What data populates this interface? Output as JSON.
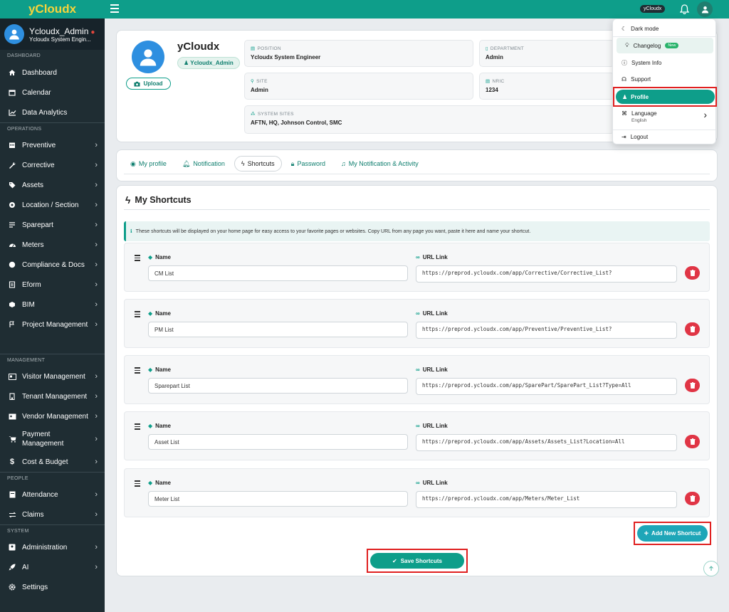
{
  "app": {
    "brand": "yCloudx",
    "top_badge": "yCloudx"
  },
  "user": {
    "name": "Ycloudx_Admin",
    "role": "Ycloudx System Engin..."
  },
  "sidebar": {
    "sections": {
      "dashboard": "DASHBOARD",
      "operations": "OPERATIONS",
      "management": "MANAGEMENT",
      "people": "PEOPLE",
      "system": "SYSTEM"
    },
    "items": {
      "dashboard": "Dashboard",
      "calendar": "Calendar",
      "analytics": "Data Analytics",
      "preventive": "Preventive",
      "corrective": "Corrective",
      "assets": "Assets",
      "location": "Location / Section",
      "sparepart": "Sparepart",
      "meters": "Meters",
      "compliance": "Compliance & Docs",
      "eform": "Eform",
      "bim": "BIM",
      "project": "Project Management",
      "visitor": "Visitor Management",
      "tenant": "Tenant Management",
      "vendor": "Vendor Management",
      "payment_1": "Payment",
      "payment_2": "Management",
      "cost": "Cost & Budget",
      "attendance": "Attendance",
      "claims": "Claims",
      "administration": "Administration",
      "ai": "AI",
      "settings": "Settings"
    }
  },
  "profile": {
    "name": "yCloudx",
    "badge": "Ycloudx_Admin",
    "upload_label": "Upload",
    "fields": {
      "position": {
        "label": "POSITION",
        "value": "Ycloudx System Engineer"
      },
      "department": {
        "label": "DEPARTMENT",
        "value": "Admin"
      },
      "site": {
        "label": "SITE",
        "value": "Admin"
      },
      "nric": {
        "label": "NRIC",
        "value": "1234"
      },
      "system_sites": {
        "label": "SYSTEM SITES",
        "value": "AFTN, HQ, Johnson Control, SMC"
      }
    }
  },
  "tabs": [
    "My profile",
    "Notification",
    "Shortcuts",
    "Password",
    "My Notification & Activity"
  ],
  "shortcuts": {
    "title": "My Shortcuts",
    "info": "These shortcuts will be displayed on your home page for easy access to your favorite pages or websites. Copy URL from any page you want, paste it here and name your shortcut.",
    "name_label": "Name",
    "url_label": "URL Link",
    "rows": [
      {
        "name": "CM List",
        "url": "https://preprod.ycloudx.com/app/Corrective/Corrective_List?"
      },
      {
        "name": "PM List",
        "url": "https://preprod.ycloudx.com/app/Preventive/Preventive_List?"
      },
      {
        "name": "Sparepart List",
        "url": "https://preprod.ycloudx.com/app/SparePart/SparePart_List?Type=All"
      },
      {
        "name": "Asset List",
        "url": "https://preprod.ycloudx.com/app/Assets/Assets_List?Location=All"
      },
      {
        "name": "Meter List",
        "url": "https://preprod.ycloudx.com/app/Meters/Meter_List"
      }
    ],
    "add_label": "Add New Shortcut",
    "save_label": "Save Shortcuts"
  },
  "dropdown": {
    "dark_mode": "Dark mode",
    "changelog": "Changelog",
    "new_badge": "New",
    "system_info": "System Info",
    "support": "Support",
    "profile": "Profile",
    "language": "Language",
    "language_value": "English",
    "logout": "Logout"
  },
  "colors": {
    "primary": "#0e9e8a",
    "sidebar": "#1f2d33",
    "danger": "#e03545",
    "accent": "#1ea6b8",
    "highlight": "#e02020"
  }
}
